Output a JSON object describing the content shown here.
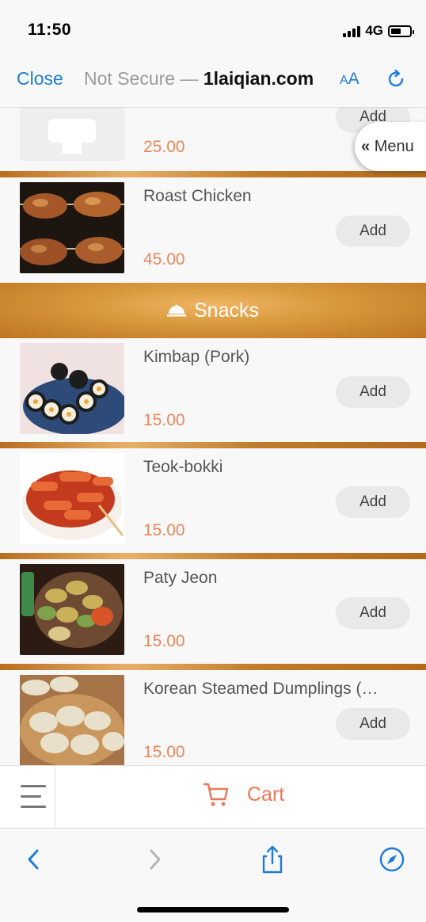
{
  "status_bar": {
    "time": "11:50",
    "network": "4G",
    "battery_level": 0.55
  },
  "browser": {
    "close_label": "Close",
    "security_text": "Not Secure — ",
    "domain": "1laiqian.com",
    "text_size_label_small": "A",
    "text_size_label_large": "A"
  },
  "menu_button": {
    "label": "Menu"
  },
  "items": [
    {
      "name": "",
      "price": "25.00",
      "add_label": "Add",
      "image": "placeholder-image"
    },
    {
      "name": "Roast Chicken",
      "price": "45.00",
      "add_label": "Add",
      "image": "roast-chicken-photo"
    },
    {
      "name": "Kimbap (Pork)",
      "price": "15.00",
      "add_label": "Add",
      "image": "kimbap-photo"
    },
    {
      "name": "Teok-bokki",
      "price": "15.00",
      "add_label": "Add",
      "image": "teokbokki-photo"
    },
    {
      "name": "Paty Jeon",
      "price": "15.00",
      "add_label": "Add",
      "image": "jeon-photo"
    },
    {
      "name": "Korean Steamed Dumplings (…",
      "price": "15.00",
      "add_label": "Add",
      "image": "dumplings-photo"
    }
  ],
  "category": {
    "label": "Snacks",
    "icon": "cloche-icon"
  },
  "cart_bar": {
    "label": "Cart"
  },
  "colors": {
    "accent": "#e8775a",
    "price": "#e8865a",
    "link": "#1f7bd8",
    "category_gold": "#d99a3c"
  }
}
